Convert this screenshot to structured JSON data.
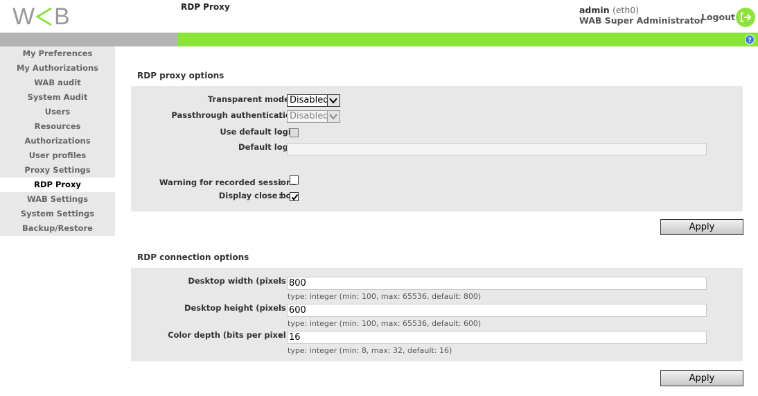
{
  "header": {
    "logo_text": "WAB",
    "user_name": "admin",
    "interface": "(eth0)",
    "role": "WAB Super Administrator",
    "logout_label": "Logout",
    "logout_icon": "logout-icon",
    "help_icon": "help-icon"
  },
  "breadcrumb": {
    "parent": "Proxy Settings",
    "current": "RDP Proxy"
  },
  "sidebar": {
    "items": [
      {
        "label": "My Preferences"
      },
      {
        "label": "My Authorizations"
      },
      {
        "label": "WAB audit"
      },
      {
        "label": "System Audit"
      },
      {
        "label": "Users"
      },
      {
        "label": "Resources"
      },
      {
        "label": "Authorizations"
      },
      {
        "label": "User profiles"
      },
      {
        "label": "Proxy Settings"
      },
      {
        "label": "RDP Proxy",
        "active": true
      },
      {
        "label": "WAB Settings"
      },
      {
        "label": "System Settings"
      },
      {
        "label": "Backup/Restore"
      }
    ]
  },
  "proxy_options": {
    "title": "RDP proxy options",
    "transparent_mode": {
      "label": "Transparent mode",
      "required": "*",
      "value": "Disabled"
    },
    "passthrough_auth": {
      "label": "Passthrough authentication",
      "value": "Disabled"
    },
    "use_default_login": {
      "label": "Use default login",
      "checked": false
    },
    "default_login": {
      "label": "Default login",
      "value": ""
    },
    "warning_recorded": {
      "label": "Warning for recorded sessions",
      "checked": false
    },
    "display_close_box": {
      "label": "Display close box",
      "checked": true
    },
    "apply_label": "Apply"
  },
  "connection_options": {
    "title": "RDP connection options",
    "desktop_width": {
      "label": "Desktop width (pixels)",
      "required": "*",
      "value": "800",
      "hint": "type: integer (min: 100, max: 65536, default: 800)"
    },
    "desktop_height": {
      "label": "Desktop height (pixels)",
      "required": "*",
      "value": "600",
      "hint": "type: integer (min: 100, max: 65536, default: 600)"
    },
    "color_depth": {
      "label": "Color depth (bits per pixel)",
      "required": "*",
      "value": "16",
      "hint": "type: integer (min: 8, max: 32, default: 16)"
    },
    "apply_label": "Apply"
  },
  "colors": {
    "accent_green": "#8ce33a",
    "nav_grey": "#b3b3b3",
    "panel_grey": "#e8e8e8",
    "required_red": "#dd2222"
  }
}
